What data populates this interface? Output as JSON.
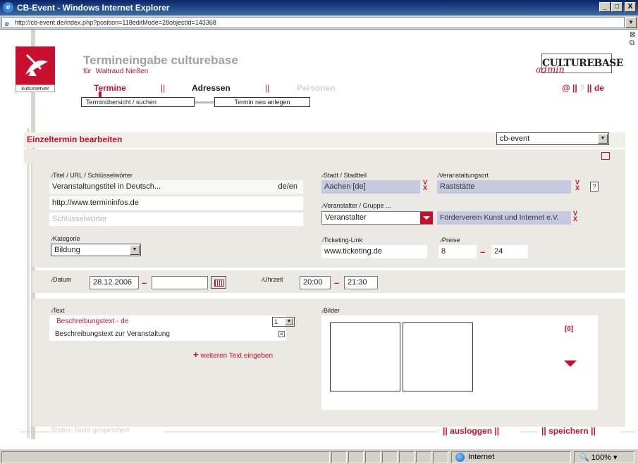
{
  "window": {
    "title": "CB-Event - Windows Internet Explorer",
    "minimize": "_",
    "maximize": "□",
    "close": "X"
  },
  "address": {
    "url": "http://cb-event.de/index.php?position=118editMode=28objectId=143368"
  },
  "header": {
    "logo_label": "kulturserver",
    "app_title": "Termineingabe culturebase",
    "for_label": "für",
    "user_name": "Waltraud Nießen",
    "brand_logo": "CULTUREBASE",
    "brand_admin": "admin"
  },
  "nav": {
    "items": [
      {
        "label": "Termine",
        "state": "active"
      },
      {
        "label": "||",
        "state": "sep"
      },
      {
        "label": "Adressen",
        "state": "normal"
      },
      {
        "label": "||",
        "state": "sep"
      },
      {
        "label": "Personen",
        "state": "disabled"
      }
    ],
    "right": {
      "at": "@",
      "sep1": "||",
      "help": "?",
      "sep2": "||",
      "lang": "de"
    },
    "sub": [
      {
        "label": "Terminübersicht / suchen"
      },
      {
        "label": "Termin neu anlegen"
      }
    ]
  },
  "section": {
    "title": "Einzeltermin bearbeiten",
    "account_select": "cb-event"
  },
  "form": {
    "title_label": "Titel / URL / Schlüsselwörter",
    "title_value": "Veranstaltungstitel in Deutsch...",
    "title_lang": "de/en",
    "url_value": "http://www.termininfos.de",
    "keywords_placeholder": "Schlüsselwörter",
    "category_label": "Kategorie",
    "category_value": "Bildung",
    "city_label": "Stadt / Stadtteil",
    "city_value": "Aachen [de]",
    "venue_label": "Veranstaltungsort",
    "venue_value": "Raststätte",
    "venue_help": "?",
    "organizer_label": "Veranstalter / Gruppe ...",
    "organizer_select": "Veranstalter",
    "organizer_value": "Förderverein Kunst und Internet e.V.",
    "ticketing_label": "Ticketing-Link",
    "ticketing_value": "www.ticketing.de",
    "price_label": "Preise",
    "price_from": "8",
    "price_to": "24",
    "dash": "–",
    "remove_glyph": "V\nX"
  },
  "datetime": {
    "date_label": "Datum",
    "date_from": "28.12.2006",
    "date_to": "",
    "time_label": "Uhrzeit",
    "time_from": "20:00",
    "time_to": "21:30"
  },
  "text_section": {
    "text_label": "Text",
    "desc_title": "Beschreibungstext - de",
    "desc_index": "1",
    "desc_value": "Beschreibungstext zur Veranstaltung",
    "add_text_plus": "+",
    "add_text": "weiteren Text eingeben",
    "images_label": "Bilder",
    "image_count": "[0]"
  },
  "footer": {
    "status_label": "Status:",
    "status_value": "Nicht gespeichert",
    "logout": "ausloggen",
    "save": "speichern",
    "sep": "||"
  },
  "statusbar": {
    "zone": "Internet",
    "zoom": "100%"
  }
}
